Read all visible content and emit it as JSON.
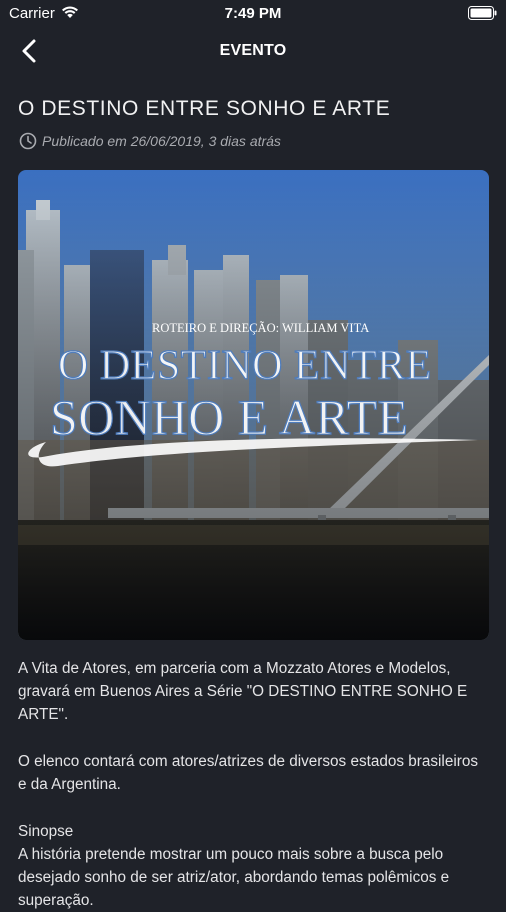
{
  "status_bar": {
    "carrier": "Carrier",
    "time": "7:49 PM"
  },
  "nav": {
    "title": "EVENTO",
    "back_icon": "chevron-left-icon"
  },
  "article": {
    "title": "O DESTINO ENTRE SONHO E ARTE",
    "published": "Publicado em 26/06/2019, 3 dias atrás",
    "banner": {
      "credit": "ROTEIRO E DIREÇÃO: WILLIAM VITA",
      "title_line1": "O DESTINO ENTRE",
      "title_line2": "SONHO E ARTE"
    },
    "paragraphs": [
      "A Vita de Atores, em parceria com a Mozzato Atores e Modelos, gravará em Buenos Aires a Série \"O DESTINO ENTRE SONHO E ARTE\".",
      "O elenco contará com atores/atrizes de diversos estados brasileiros e da Argentina."
    ],
    "synopsis_heading": "Sinopse",
    "synopsis_text": "A história pretende mostrar um pouco mais sobre a busca pelo desejado sonho de ser atriz/ator, abordando temas polêmicos e superação."
  },
  "colors": {
    "background": "#1f2229",
    "text": "#e9e9ea",
    "meta": "#a9abb0"
  }
}
